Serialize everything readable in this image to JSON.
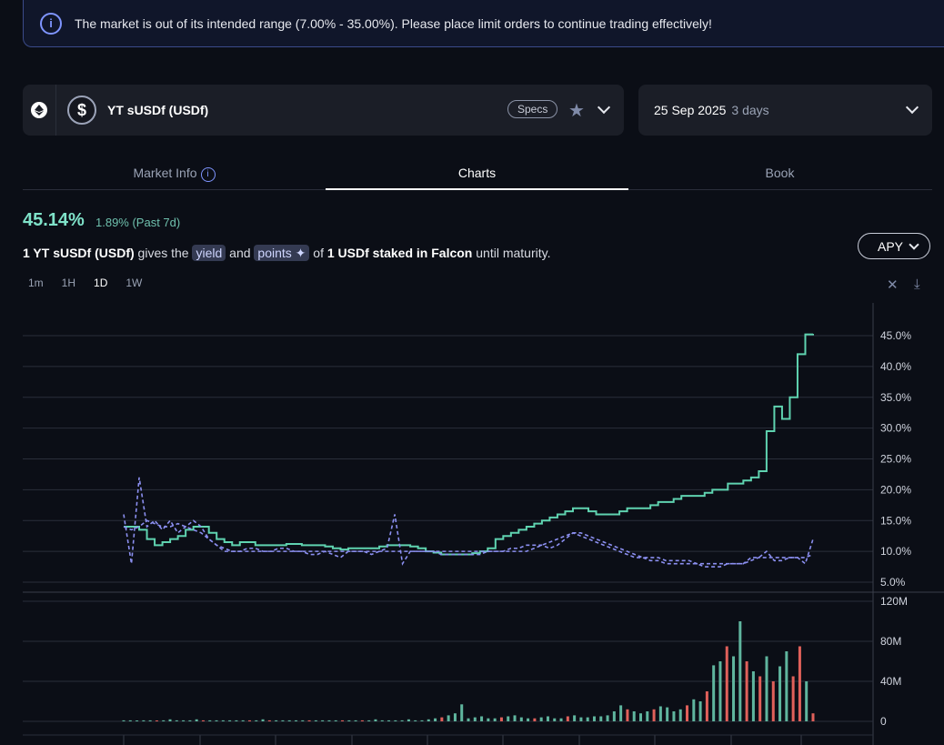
{
  "banner": {
    "icon": "info-icon",
    "text": "The market is out of its intended range (7.00% - 35.00%). Please place limit orders to continue trading effectively!"
  },
  "market": {
    "chain_icon": "ethereum-icon",
    "token_icon": "dollar-icon",
    "name": "YT sUSDf (USDf)",
    "specs_label": "Specs"
  },
  "maturity": {
    "date": "25 Sep 2025",
    "remaining": "3 days"
  },
  "tabs": [
    {
      "label": "Market Info",
      "active": false
    },
    {
      "label": "Charts",
      "active": true
    },
    {
      "label": "Book",
      "active": false
    }
  ],
  "stats": {
    "apy": "45.14%",
    "change": "1.89% (Past 7d)"
  },
  "description": {
    "part1": "1 YT sUSDf (USDf)",
    "part2": " gives the ",
    "yield": "yield",
    "part3": " and ",
    "points": "points",
    "part4": " of ",
    "part5": "1 USDf staked in Falcon",
    "part6": " until maturity."
  },
  "apy_selector": "APY",
  "intervals": [
    "1m",
    "1H",
    "1D",
    "1W"
  ],
  "active_interval": "1D",
  "colors": {
    "implied": "#5fd3b0",
    "underlying": "#8b8ff0",
    "volume_up": "#5fb59e",
    "volume_down": "#e0605a"
  },
  "chart_data": [
    {
      "type": "line",
      "y_ticks": [
        "45.0%",
        "40.0%",
        "35.0%",
        "30.0%",
        "25.0%",
        "20.0%",
        "15.0%",
        "10.0%",
        "5.0%"
      ],
      "ylim": [
        5,
        45
      ],
      "series": [
        {
          "style": "solid",
          "values": [
            14,
            14,
            13.5,
            12,
            11,
            11.5,
            12,
            12.5,
            13.5,
            14,
            14,
            13,
            12,
            11.5,
            11,
            11.5,
            11.5,
            11,
            11,
            11,
            11,
            11.2,
            11.2,
            11,
            11,
            11,
            10.8,
            10.5,
            10.3,
            10.5,
            10.5,
            10.5,
            10.5,
            10.8,
            11,
            11,
            11,
            10.8,
            10.5,
            10,
            9.8,
            9.5,
            9.5,
            9.5,
            9.5,
            9.7,
            10,
            10.5,
            12,
            12.5,
            13,
            13.5,
            14,
            14.5,
            15,
            15.5,
            16,
            16.5,
            17,
            17,
            16.5,
            16,
            16,
            16,
            16.5,
            17,
            17,
            17,
            17.5,
            18,
            18,
            18.5,
            19,
            19,
            19,
            19.5,
            20,
            20,
            21,
            21,
            21.5,
            22,
            23,
            29.5,
            33.5,
            31.5,
            35,
            42,
            45.2,
            45.3
          ]
        },
        {
          "style": "dashed",
          "values": [
            16,
            8,
            22,
            14,
            15,
            13.5,
            15,
            13,
            14,
            15,
            14,
            12,
            11,
            10,
            10,
            10,
            10.5,
            10.5,
            10,
            10,
            10.5,
            10.5,
            10,
            10,
            9.5,
            9.5,
            10,
            9.5,
            9,
            10,
            10,
            10,
            9.5,
            10,
            10.5,
            16,
            8,
            10,
            10,
            10,
            10,
            9.5,
            9.5,
            9.5,
            9.5,
            9.5,
            9.5,
            10,
            10,
            10,
            10.5,
            10.5,
            11,
            11,
            11,
            10.5,
            11,
            12,
            13,
            12.5,
            12,
            11.5,
            11,
            10.5,
            10,
            9.5,
            9,
            9,
            8.5,
            8.5,
            8,
            8,
            8,
            8,
            8,
            7.5,
            7.5,
            7.5,
            8,
            8,
            8,
            9,
            9,
            10,
            8.5,
            8.5,
            9,
            9,
            8,
            12
          ]
        },
        {
          "style": "dashed",
          "values": [
            14,
            13.5,
            14,
            15,
            14.5,
            14,
            14,
            14.5,
            14,
            13.5,
            13,
            12,
            11,
            10.5,
            10,
            10,
            10,
            10,
            10,
            10,
            10,
            10,
            10,
            10,
            10,
            10,
            10,
            10,
            10,
            10,
            10,
            10,
            10,
            10,
            10,
            10,
            10,
            10,
            10,
            10,
            10,
            10,
            10,
            10,
            10,
            10,
            10,
            10,
            10,
            10,
            10,
            10,
            10,
            10.5,
            11,
            11.5,
            12,
            12.5,
            13,
            13,
            12.5,
            12,
            11.5,
            11,
            10.5,
            10,
            9.5,
            9,
            9,
            9,
            8.5,
            8.5,
            8.5,
            8.5,
            8,
            8,
            8,
            8,
            8,
            8,
            8,
            8.5,
            9,
            9,
            9,
            9,
            9,
            9,
            9,
            9.5
          ]
        }
      ]
    },
    {
      "type": "bar",
      "y_ticks": [
        "120M",
        "80M",
        "40M",
        "0"
      ],
      "ylim": [
        0,
        120
      ],
      "values": [
        1,
        1,
        0.5,
        1,
        1,
        0.5,
        1,
        2,
        1,
        1,
        1,
        2,
        1,
        1,
        1,
        1,
        1,
        1,
        1,
        1,
        1,
        2,
        1,
        1,
        1,
        1,
        1,
        1,
        1,
        1,
        1,
        1,
        1,
        1,
        1,
        1,
        1,
        1,
        2,
        1,
        1,
        1,
        1,
        2,
        1,
        1,
        2,
        3,
        4,
        6,
        8,
        17,
        3,
        4,
        5,
        3,
        3,
        4,
        5,
        6,
        4,
        3,
        3,
        4,
        5,
        3,
        3,
        5,
        6,
        4,
        4,
        5,
        5,
        6,
        10,
        16,
        12,
        10,
        8,
        10,
        12,
        15,
        14,
        10,
        12,
        16,
        22,
        20,
        30,
        56,
        60,
        75,
        65,
        100,
        60,
        50,
        45,
        65,
        40,
        55,
        70,
        45,
        75,
        40,
        8
      ],
      "down_indices": [
        5,
        12,
        19,
        22,
        28,
        33,
        36,
        48,
        57,
        62,
        67,
        76,
        80,
        85,
        88,
        91,
        94,
        96,
        98,
        101,
        102,
        104
      ]
    }
  ]
}
